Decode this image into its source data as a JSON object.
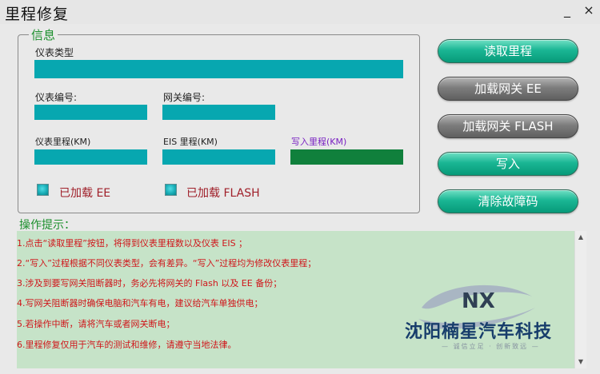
{
  "window": {
    "title": "里程修复",
    "minimize": "_",
    "close": "×"
  },
  "info": {
    "legend": "信息",
    "meter_type_label": "仪表类型",
    "meter_no_label": "仪表编号:",
    "gateway_no_label": "网关编号:",
    "meter_mileage_label": "仪表里程(KM)",
    "eis_mileage_label": "EIS 里程(KM)",
    "write_mileage_label": "写入里程(KM)",
    "loaded_ee_label": "已加载 EE",
    "loaded_flash_label": "已加载 FLASH"
  },
  "buttons": {
    "read_mileage": "读取里程",
    "load_gateway_ee": "加载网关 EE",
    "load_gateway_flash": "加载网关 FLASH",
    "write": "写入",
    "clear_faults": "清除故障码"
  },
  "hints": {
    "title": "操作提示：",
    "lines": [
      "1.点击“读取里程”按钮，将得到仪表里程数以及仪表 EIS ；",
      "2.“写入”过程根据不同仪表类型，会有差异。“写入”过程均为修改仪表里程；",
      "3.涉及到要写网关阻断器时，务必先将网关的 Flash 以及 EE 备份；",
      "4.写网关阻断器时确保电脑和汽车有电，建议给汽车单独供电；",
      "5.若操作中断，请将汽车或者网关断电；",
      "6.里程修复仅用于汽车的测试和维修，请遵守当地法律。"
    ]
  },
  "watermark": {
    "company": "沈阳楠星汽车科技",
    "slogan": "— 诚信立足 · 创新致远 —"
  },
  "colors": {
    "field": "#07a7b0",
    "write_field": "#10803c",
    "hint_bg": "#c6e3c8",
    "hint_text": "#d0151a",
    "legend": "#1b8f2c"
  }
}
